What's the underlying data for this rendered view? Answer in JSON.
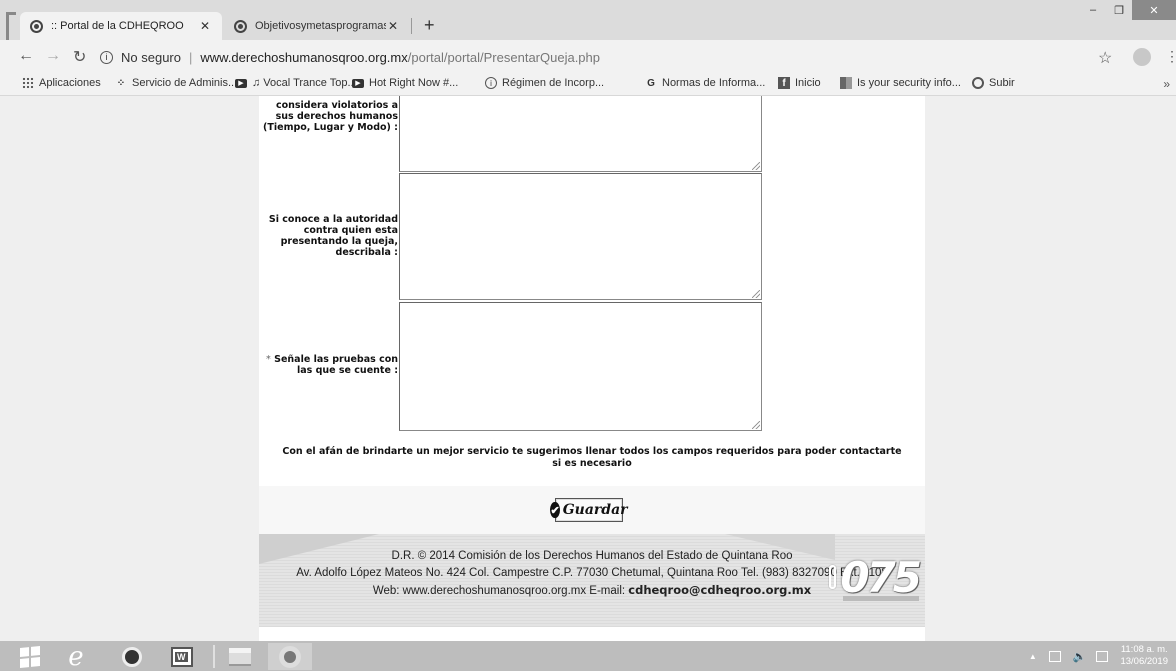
{
  "browser": {
    "tabs": [
      {
        "title": ":: Portal de la CDHEQROO",
        "active": true
      },
      {
        "title": "Objetivosymetasprogramasaprob",
        "active": false
      }
    ],
    "address": {
      "security": "No seguro",
      "host": "www.derechoshumanosqroo.org.mx",
      "path": "/portal/portal/PresentarQueja.php"
    },
    "bookmarks": [
      {
        "label": "Aplicaciones",
        "icon": "apps-grid-icon"
      },
      {
        "label": "Servicio de Adminis...",
        "icon": "sat-icon"
      },
      {
        "label": "♫ Vocal Trance Top...",
        "icon": "youtube-icon"
      },
      {
        "label": "Hot Right Now #...",
        "icon": "youtube-icon"
      },
      {
        "label": "Régimen de Incorp...",
        "icon": "info-icon"
      },
      {
        "label": "Normas de Informa...",
        "icon": "google-icon"
      },
      {
        "label": "Inicio",
        "icon": "facebook-icon"
      },
      {
        "label": "Is your security info...",
        "icon": "microsoft-icon"
      },
      {
        "label": "Subir",
        "icon": "globe-icon"
      }
    ],
    "bookmarks_more": "»"
  },
  "form": {
    "field1_label_lines": [
      "considera violatorios a",
      "sus derechos humanos",
      "(Tiempo, Lugar y Modo) :"
    ],
    "field2_label_lines": [
      "Si conoce a la autoridad",
      "contra quien esta",
      "presentando la queja,",
      "describala :"
    ],
    "field3_required": "*",
    "field3_label_lines": [
      "Señale las pruebas con",
      "las que se cuente :"
    ],
    "note": "Con el afán de brindarte un mejor servicio te sugerimos llenar todos los campos requeridos para poder contactarte si es necesario",
    "save_label": "Guardar"
  },
  "footer": {
    "line1": "D.R. © 2014 Comisión de los Derechos Humanos del Estado de Quintana Roo",
    "line2": "Av. Adolfo López Mateos No. 424 Col. Campestre C.P. 77030 Chetumal, Quintana Roo Tel. (983) 8327090 Ext. 1108",
    "line3_web": "Web: www.derechoshumanosqroo.org.mx  E-mail: ",
    "line3_email": "cdheqroo@cdheqroo.org.mx",
    "logo_text": "075"
  },
  "taskbar": {
    "time": "11:08 a. m.",
    "date": "13/06/2019"
  }
}
